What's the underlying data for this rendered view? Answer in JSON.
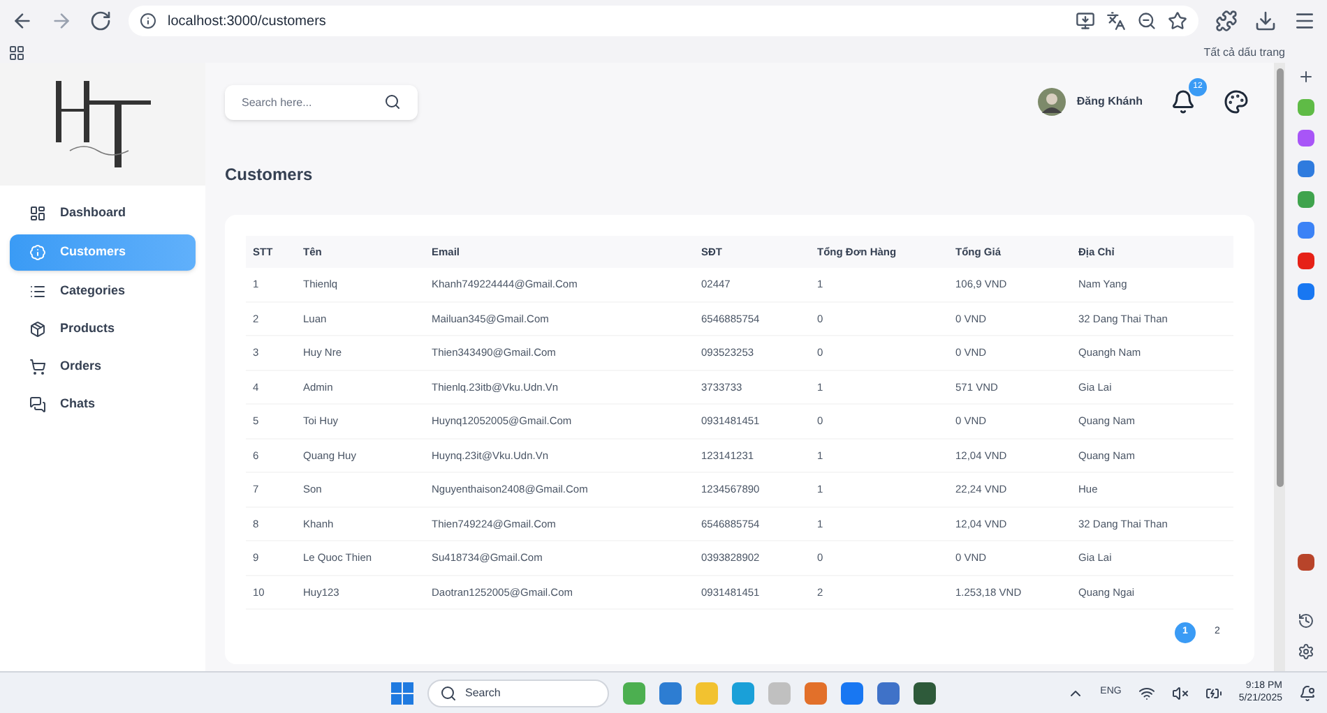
{
  "browser": {
    "url": "localhost:3000/customers",
    "bookmarks_label": "Tất cả dấu trang"
  },
  "sidebar": {
    "items": [
      {
        "label": "Dashboard",
        "selected": false
      },
      {
        "label": "Customers",
        "selected": true
      },
      {
        "label": "Categories",
        "selected": false
      },
      {
        "label": "Products",
        "selected": false
      },
      {
        "label": "Orders",
        "selected": false
      },
      {
        "label": "Chats",
        "selected": false
      }
    ]
  },
  "header": {
    "search": {
      "placeholder": "Search here..."
    },
    "user_name": "Đăng Khánh",
    "notification_count": "12"
  },
  "page_title": "Customers",
  "table": {
    "columns": [
      "STT",
      "Tên",
      "Email",
      "SĐT",
      "Tổng Đơn Hàng",
      "Tổng Giá",
      "Địa Chỉ"
    ],
    "rows": [
      [
        "1",
        "Thienlq",
        "Khanh749224444@Gmail.Com",
        "02447",
        "1",
        "106,9 VND",
        "Nam Yang"
      ],
      [
        "2",
        "Luan",
        "Mailuan345@Gmail.Com",
        "6546885754",
        "0",
        "0 VND",
        "32 Dang Thai Than"
      ],
      [
        "3",
        "Huy Nre",
        "Thien343490@Gmail.Com",
        "093523253",
        "0",
        "0 VND",
        "Quangh Nam"
      ],
      [
        "4",
        "Admin",
        "Thienlq.23itb@Vku.Udn.Vn",
        "3733733",
        "1",
        "571 VND",
        "Gia Lai"
      ],
      [
        "5",
        "Toi Huy",
        "Huynq12052005@Gmail.Com",
        "0931481451",
        "0",
        "0 VND",
        "Quang Nam"
      ],
      [
        "6",
        "Quang Huy",
        "Huynq.23it@Vku.Udn.Vn",
        "123141231",
        "1",
        "12,04 VND",
        "Quang Nam"
      ],
      [
        "7",
        "Son",
        "Nguyenthaison2408@Gmail.Com",
        "1234567890",
        "1",
        "22,24 VND",
        "Hue"
      ],
      [
        "8",
        "Khanh",
        "Thien749224@Gmail.Com",
        "6546885754",
        "1",
        "12,04 VND",
        "32 Dang Thai Than"
      ],
      [
        "9",
        "Le Quoc Thien",
        "Su418734@Gmail.Com",
        "0393828902",
        "0",
        "0 VND",
        "Gia Lai"
      ],
      [
        "10",
        "Huy123",
        "Daotran1252005@Gmail.Com",
        "0931481451",
        "2",
        "1.253,18 VND",
        "Quang Ngai"
      ]
    ]
  },
  "pagination": [
    {
      "label": "1",
      "selected": true
    },
    {
      "label": "2",
      "selected": false
    }
  ],
  "taskbar": {
    "search_placeholder": "Search",
    "language": "ENG",
    "time": "9:18 PM",
    "date": "5/21/2025"
  }
}
